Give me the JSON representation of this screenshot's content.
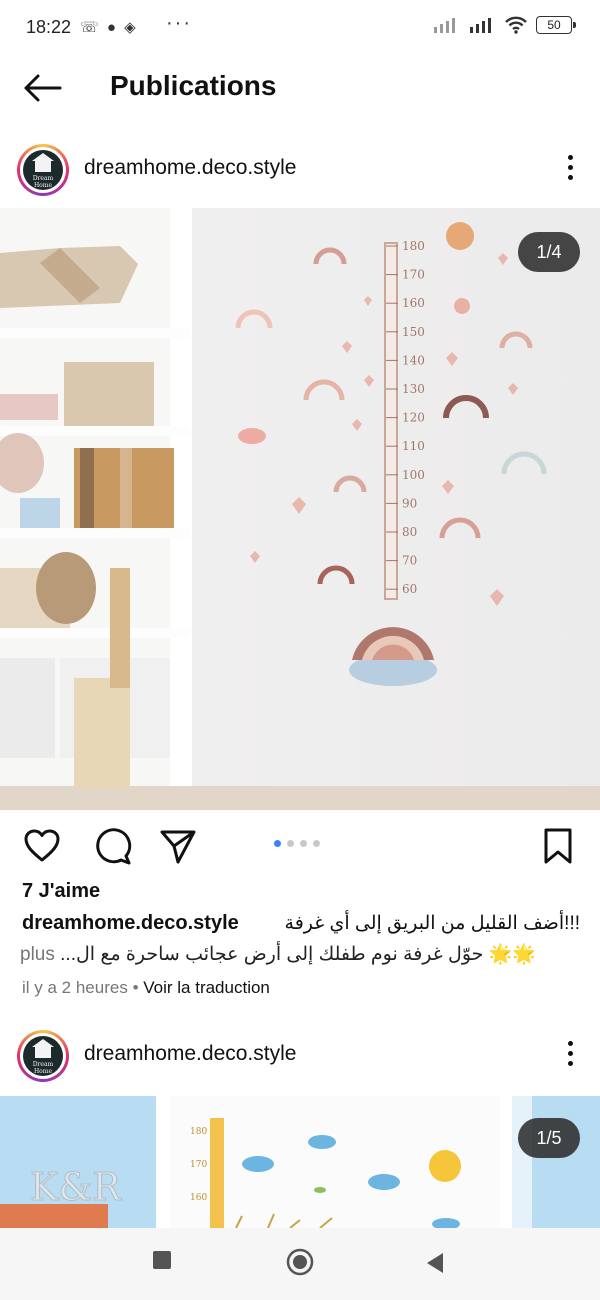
{
  "status_bar": {
    "time": "18:22",
    "battery": "50"
  },
  "app_bar": {
    "title": "Publications"
  },
  "posts": [
    {
      "username": "dreamhome.deco.style",
      "avatar_text": "Dream Home",
      "media_counter": "1/4",
      "likes": "7 J'aime",
      "caption_line1": "!!!أضف القليل من البريق إلى أي غرفة",
      "caption_line2": "🌟🌟 حوّل غرفة نوم طفلك إلى أرض عجائب ساحرة مع ال...",
      "caption_more": "plus",
      "time_ago": "il y a 2 heures",
      "translate_label": "Voir la traduction",
      "ruler_ticks": [
        "180",
        "170",
        "160",
        "150",
        "140",
        "130",
        "120",
        "110",
        "100",
        "90",
        "80",
        "70",
        "60"
      ]
    },
    {
      "username": "dreamhome.deco.style",
      "avatar_text": "Dream Home",
      "media_counter": "1/5",
      "photo_text": "K&R",
      "ruler_ticks": [
        "180",
        "170",
        "160"
      ]
    }
  ],
  "carousel": {
    "pages": 4,
    "active": 1
  },
  "colors": {
    "accent": "#3b82f6",
    "text": "#111111",
    "secondary_text": "#777777"
  },
  "icons": [
    "back-arrow-icon",
    "more-icon",
    "heart-icon",
    "comment-icon",
    "share-icon",
    "bookmark-icon",
    "square-icon",
    "circle-icon",
    "triangle-back-icon"
  ]
}
